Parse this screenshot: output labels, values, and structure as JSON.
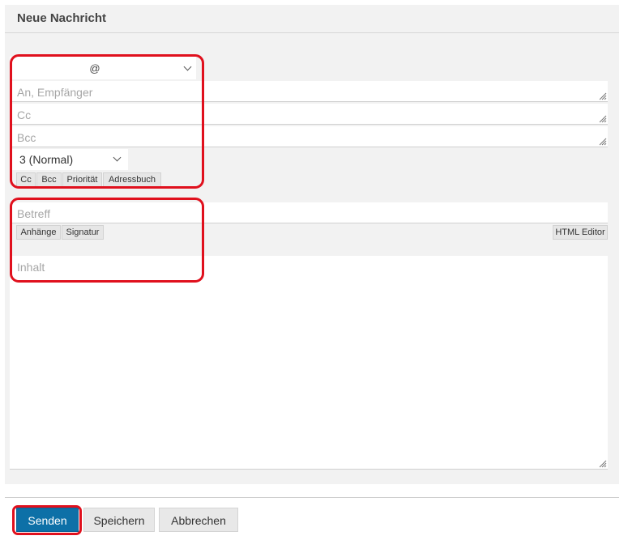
{
  "form": {
    "title": "Neue Nachricht",
    "from_value": "@",
    "to_placeholder": "An, Empfänger",
    "cc_placeholder": "Cc",
    "bcc_placeholder": "Bcc",
    "priority_value": "3 (Normal)",
    "recipient_buttons": [
      "Cc",
      "Bcc",
      "Priorität",
      "Adressbuch"
    ],
    "subject_placeholder": "Betreff",
    "attach_label": "Anhänge",
    "signature_label": "Signatur",
    "html_editor_label": "HTML Editor",
    "body_placeholder": "Inhalt"
  },
  "actions": {
    "send_label": "Senden",
    "save_label": "Speichern",
    "cancel_label": "Abbrechen"
  },
  "colors": {
    "primary": "#0d70a7",
    "highlight": "#e0101d",
    "panel_bg": "#f2f2f2"
  }
}
